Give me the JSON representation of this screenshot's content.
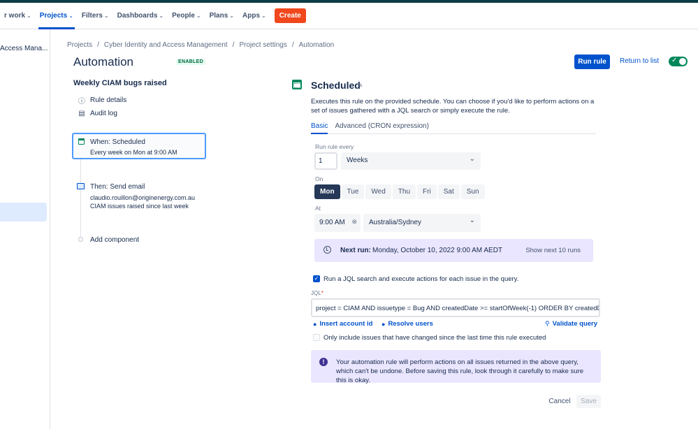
{
  "nav": {
    "items": [
      {
        "label": "r work"
      },
      {
        "label": "Projects",
        "active": true
      },
      {
        "label": "Filters"
      },
      {
        "label": "Dashboards"
      },
      {
        "label": "People"
      },
      {
        "label": "Plans"
      },
      {
        "label": "Apps"
      }
    ],
    "create_label": "Create"
  },
  "sidebar": {
    "project_label": "Access Mana..."
  },
  "breadcrumb": [
    "Projects",
    "Cyber Identity and Access Management",
    "Project settings",
    "Automation"
  ],
  "header": {
    "title": "Automation",
    "badge": "ENABLED",
    "run_rule": "Run rule",
    "return_to_list": "Return to list",
    "toggle_check": "✓"
  },
  "rule": {
    "name": "Weekly CIAM bugs raised",
    "links": [
      "Rule details",
      "Audit log"
    ],
    "trigger": {
      "title": "When: Scheduled",
      "subtitle": "Every week on Mon at 9:00 AM"
    },
    "action": {
      "title": "Then: Send email",
      "line1": "claudio.rouillon@originenergy.com.au",
      "line2": "CIAM issues raised since last week"
    },
    "add_component": "Add component"
  },
  "panel": {
    "title": "Scheduled",
    "description": "Executes this rule on the provided schedule. You can choose if you'd like to perform actions on a set of issues gathered with a JQL search or simply execute the rule.",
    "tabs": [
      "Basic",
      "Advanced (CRON expression)"
    ],
    "run_every_label": "Run rule every",
    "run_every_value": "1",
    "run_every_unit": "Weeks",
    "on_label": "On",
    "days": [
      "Mon",
      "Tue",
      "Wed",
      "Thu",
      "Fri",
      "Sat",
      "Sun"
    ],
    "selected_day": "Mon",
    "at_label": "At",
    "time_value": "9:00 AM",
    "timezone": "Australia/Sydney",
    "next_run_label": "Next run:",
    "next_run_value": "Monday, October 10, 2022 9:00 AM AEDT",
    "show_next": "Show next 10 runs",
    "jql_checkbox": {
      "label": "Run a JQL search and execute actions for each issue in the query.",
      "checked": true
    },
    "jql_label": "JQL",
    "jql_required": "*",
    "jql_value": "project = CIAM AND issuetype = Bug AND createdDate >= startOfWeek(-1) ORDER BY createdDate",
    "insert_account_id": "Insert account id",
    "resolve_users": "Resolve users",
    "validate_query": "Validate query",
    "only_changed": {
      "label": "Only include issues that have changed since the last time this rule executed",
      "checked": false
    },
    "warning": "Your automation rule will perform actions on all issues returned in the above query, which can't be undone. Before saving this rule, look through it carefully to make sure this is okay.",
    "cancel": "Cancel",
    "save": "Save"
  },
  "colors": {
    "primary": "#0052cc",
    "create": "#f1471d",
    "success": "#00875a",
    "topbar": "#0b3d47",
    "info_bg": "#eae6ff"
  }
}
